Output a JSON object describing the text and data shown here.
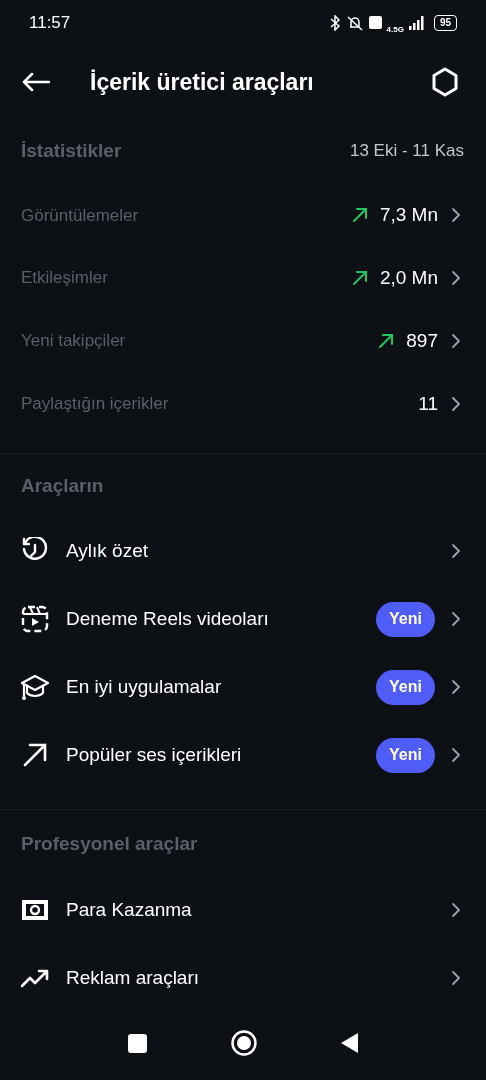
{
  "status_bar": {
    "time": "11:57",
    "network": "4.5G",
    "battery": "95"
  },
  "header": {
    "title": "İçerik üretici araçları"
  },
  "stats": {
    "heading": "İstatistikler",
    "date_range": "13 Eki - 11 Kas",
    "rows": [
      {
        "label": "Görüntülemeler",
        "value": "7,3 Mn",
        "trending_up": true
      },
      {
        "label": "Etkileşimler",
        "value": "2,0 Mn",
        "trending_up": true
      },
      {
        "label": "Yeni takipçiler",
        "value": "897",
        "trending_up": true
      },
      {
        "label": "Paylaştığın içerikler",
        "value": "11",
        "trending_up": false
      }
    ]
  },
  "tools": {
    "heading": "Araçların",
    "items": [
      {
        "kind": "history",
        "label": "Aylık özet"
      },
      {
        "kind": "reels",
        "label": "Deneme Reels videoları",
        "badge": "Yeni"
      },
      {
        "kind": "cap",
        "label": "En iyi uygulamalar",
        "badge": "Yeni"
      },
      {
        "kind": "arrow",
        "label": "Popüler ses içerikleri",
        "badge": "Yeni"
      }
    ]
  },
  "pro_tools": {
    "heading": "Profesyonel araçlar",
    "items": [
      {
        "kind": "money",
        "label": "Para Kazanma"
      },
      {
        "kind": "trend",
        "label": "Reklam araçları"
      }
    ]
  }
}
